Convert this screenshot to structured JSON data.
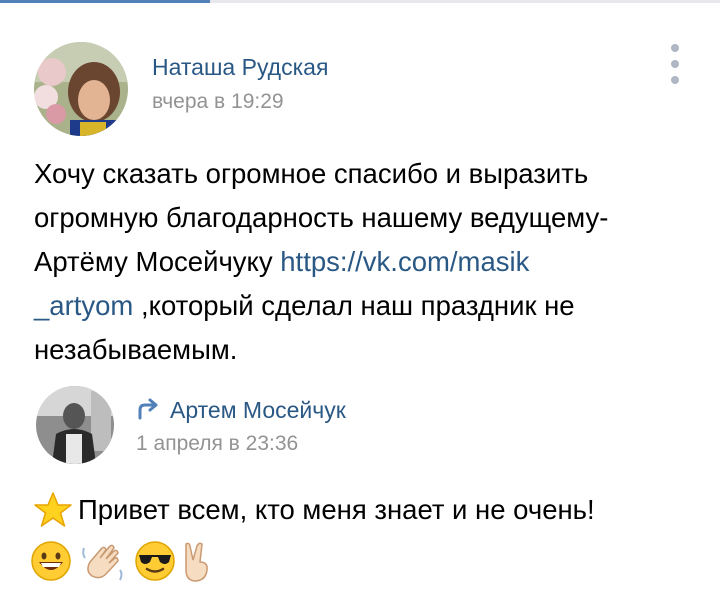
{
  "post": {
    "author": "Наташа Рудская",
    "time": "вчера в 19:29",
    "text_line1": "Хочу сказать огромное спасибо и выразить",
    "text_line2": "огромную благодарность нашему ведущему-",
    "text_line3_prefix": "Артёму Мосейчуку ",
    "link_part1": "https://vk.com/masik",
    "link_part2": "_artyom",
    "text_line4_suffix": " ,который сделал наш праздник не",
    "text_line5": "незабываемым."
  },
  "repost": {
    "author": "Артем Мосейчук",
    "time": "1 апреля в 23:36",
    "text": "Привет всем, кто меня знает и не очень!"
  },
  "icons": {
    "more": "more-vertical-icon",
    "repost": "repost-arrow-icon",
    "star": "star-emoji",
    "emojis": [
      "grinning-face-emoji",
      "waving-hand-emoji",
      "sunglasses-face-emoji",
      "victory-hand-emoji"
    ]
  },
  "colors": {
    "link": "#2a5885",
    "meta": "#939393",
    "active_tab": "#5181b8"
  }
}
